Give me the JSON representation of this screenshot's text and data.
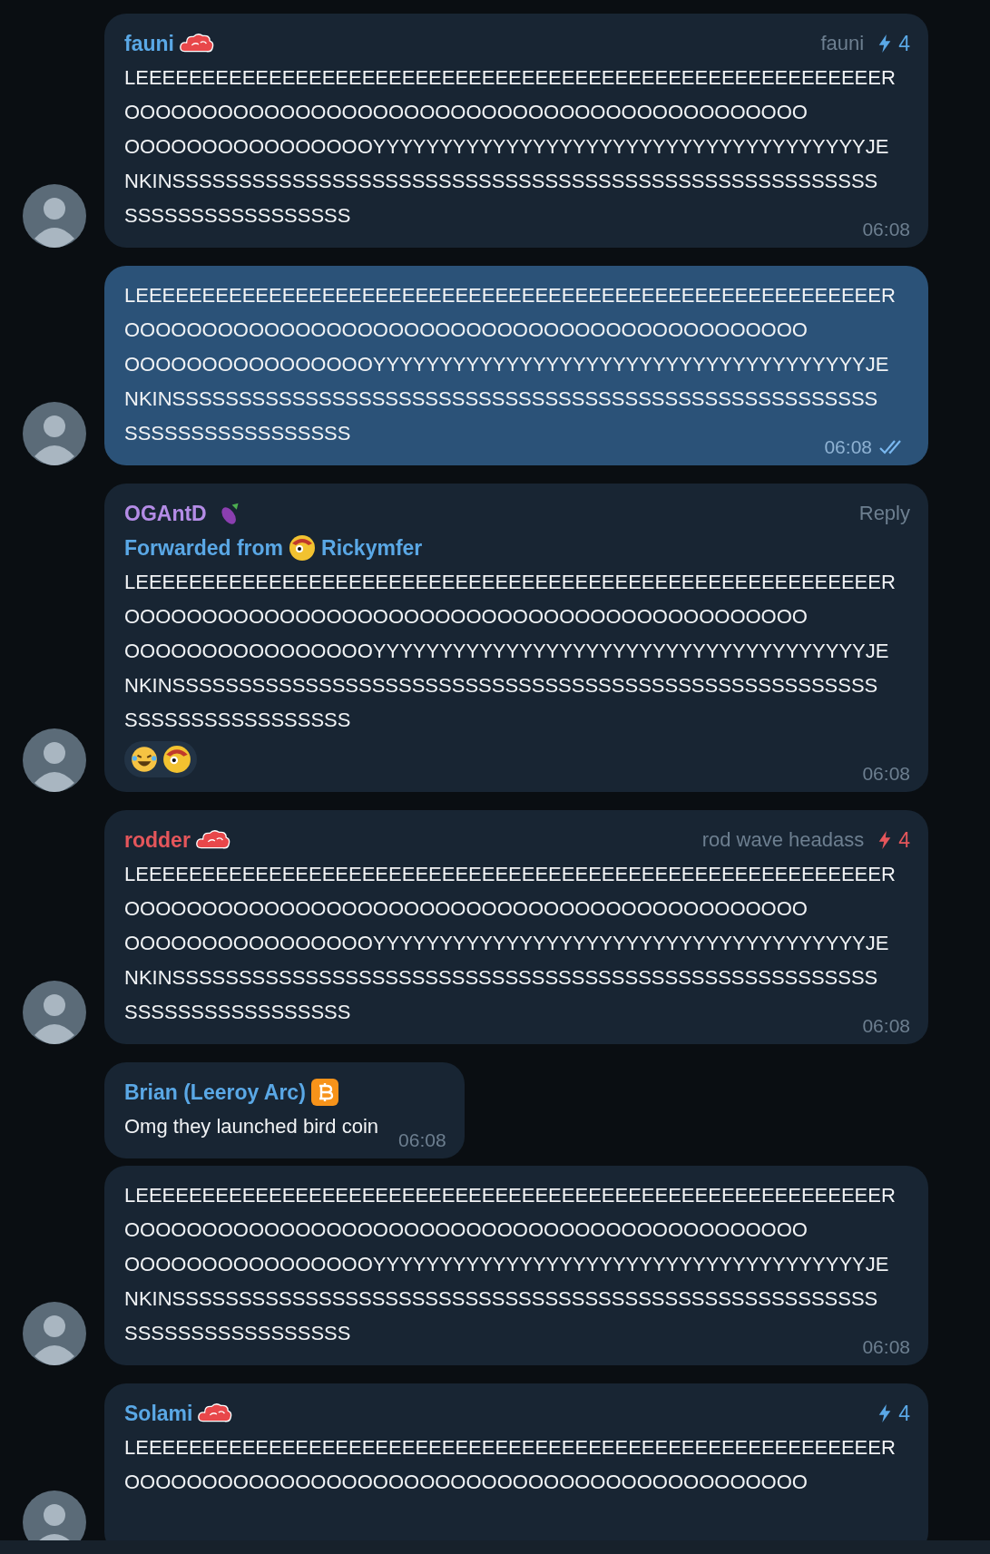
{
  "messages": [
    {
      "sender": "fauni",
      "color": "#5aa8e6",
      "name_icon": {
        "kind": "cloud"
      },
      "avatar": true,
      "outgoing": false,
      "badge": {
        "label": "fauni",
        "count": "4",
        "color": "#5aa8e6"
      },
      "lines": [
        "LEEEEEEEEEEEEEEEEEEEEEEEEEEEEEEEEEEEEEEEEEEEEEEEEEEEEEEEER",
        "OOOOOOOOOOOOOOOOOOOOOOOOOOOOOOOOOOOOOOOOOOOO",
        "OOOOOOOOOOOOOOOOYYYYYYYYYYYYYYYYYYYYYYYYYYYYYYYYYYYYYJE",
        "NKINSSSSSSSSSSSSSSSSSSSSSSSSSSSSSSSSSSSSSSSSSSSSSSSSSSSSS",
        "SSSSSSSSSSSSSSSSS"
      ],
      "time": "06:08"
    },
    {
      "outgoing": true,
      "read": true,
      "avatar": true,
      "lines": [
        "LEEEEEEEEEEEEEEEEEEEEEEEEEEEEEEEEEEEEEEEEEEEEEEEEEEEEEEEER",
        "OOOOOOOOOOOOOOOOOOOOOOOOOOOOOOOOOOOOOOOOOOOO",
        "OOOOOOOOOOOOOOOOYYYYYYYYYYYYYYYYYYYYYYYYYYYYYYYYYYYYYJE",
        "NKINSSSSSSSSSSSSSSSSSSSSSSSSSSSSSSSSSSSSSSSSSSSSSSSSSSSSS",
        "SSSSSSSSSSSSSSSSS"
      ],
      "time": "06:08"
    },
    {
      "sender": "OGAntD",
      "color": "#b48ce6",
      "name_icon": {
        "kind": "eggplant"
      },
      "avatar": true,
      "outgoing": false,
      "reply_label": "Reply",
      "forwarded": {
        "label": "Forwarded from",
        "source": "Rickymfer"
      },
      "lines": [
        "LEEEEEEEEEEEEEEEEEEEEEEEEEEEEEEEEEEEEEEEEEEEEEEEEEEEEEEEER",
        "OOOOOOOOOOOOOOOOOOOOOOOOOOOOOOOOOOOOOOOOOOOO",
        "OOOOOOOOOOOOOOOOYYYYYYYYYYYYYYYYYYYYYYYYYYYYYYYYYYYYYJE",
        "NKINSSSSSSSSSSSSSSSSSSSSSSSSSSSSSSSSSSSSSSSSSSSSSSSSSSSSS",
        "SSSSSSSSSSSSSSSSS"
      ],
      "reactions": [
        {
          "kind": "laugh"
        },
        {
          "kind": "sticker"
        }
      ],
      "time": "06:08"
    },
    {
      "sender": "rodder",
      "color": "#e5565b",
      "name_icon": {
        "kind": "cloud"
      },
      "avatar": true,
      "outgoing": false,
      "badge": {
        "label": "rod wave headass",
        "count": "4",
        "color": "#e5565b"
      },
      "lines": [
        "LEEEEEEEEEEEEEEEEEEEEEEEEEEEEEEEEEEEEEEEEEEEEEEEEEEEEEEEER",
        "OOOOOOOOOOOOOOOOOOOOOOOOOOOOOOOOOOOOOOOOOOOO",
        "OOOOOOOOOOOOOOOOYYYYYYYYYYYYYYYYYYYYYYYYYYYYYYYYYYYYYJE",
        "NKINSSSSSSSSSSSSSSSSSSSSSSSSSSSSSSSSSSSSSSSSSSSSSSSSSSSSS",
        "SSSSSSSSSSSSSSSSS"
      ],
      "time": "06:08"
    },
    {
      "sender": "Brian (Leeroy Arc)",
      "color": "#5aa8e6",
      "name_icon": {
        "kind": "bitcoin"
      },
      "avatar": false,
      "outgoing": false,
      "text": "Omg they launched bird coin",
      "time": "06:08"
    },
    {
      "outgoing": false,
      "avatar": true,
      "lines": [
        "LEEEEEEEEEEEEEEEEEEEEEEEEEEEEEEEEEEEEEEEEEEEEEEEEEEEEEEEER",
        "OOOOOOOOOOOOOOOOOOOOOOOOOOOOOOOOOOOOOOOOOOOO",
        "OOOOOOOOOOOOOOOOYYYYYYYYYYYYYYYYYYYYYYYYYYYYYYYYYYYYYJE",
        "NKINSSSSSSSSSSSSSSSSSSSSSSSSSSSSSSSSSSSSSSSSSSSSSSSSSSSSS",
        "SSSSSSSSSSSSSSSSS"
      ],
      "time": "06:08"
    },
    {
      "sender": "Solami",
      "color": "#5aa8e6",
      "name_icon": {
        "kind": "cloud"
      },
      "avatar": true,
      "outgoing": false,
      "badge": {
        "count": "4",
        "color": "#5aa8e6"
      },
      "lines": [
        "LEEEEEEEEEEEEEEEEEEEEEEEEEEEEEEEEEEEEEEEEEEEEEEEEEEEEEEEER",
        "OOOOOOOOOOOOOOOOOOOOOOOOOOOOOOOOOOOOOOOOOOOO"
      ]
    }
  ]
}
